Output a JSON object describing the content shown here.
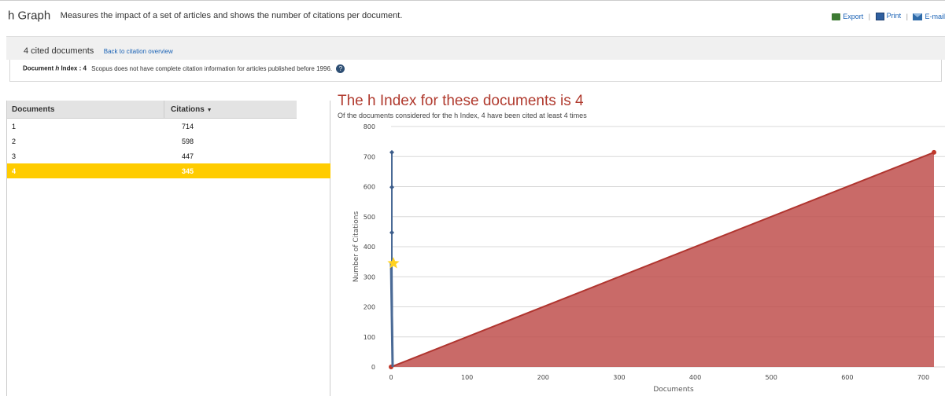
{
  "header": {
    "title": "h Graph",
    "description": "Measures the impact of a set of articles and shows the number of citations per document.",
    "export_label": "Export",
    "print_label": "Print",
    "email_label": "E-mail",
    "separator": "|"
  },
  "cited": {
    "count_text": "4 cited documents",
    "back_link": "Back to citation overview"
  },
  "hindex_box": {
    "prefix": "Document ",
    "h_letter": "h",
    "suffix": " Index : 4",
    "note": "Scopus does not have complete citation information for articles published before 1996.",
    "help_glyph": "?"
  },
  "table": {
    "col_documents": "Documents",
    "col_citations": "Citations",
    "sort_glyph": "▼",
    "rows": [
      {
        "doc": "1",
        "citations": "714"
      },
      {
        "doc": "2",
        "citations": "598"
      },
      {
        "doc": "3",
        "citations": "447"
      },
      {
        "doc": "4",
        "citations": "345"
      }
    ],
    "highlight_color": "#ffcc00"
  },
  "chart": {
    "title": "The h Index for these documents is 4",
    "subtitle": "Of the documents considered for the h Index, 4 have been cited at least 4 times"
  },
  "chart_data": {
    "type": "line",
    "xlabel": "Documents",
    "ylabel": "Number of Citations",
    "xlim": [
      0,
      714
    ],
    "ylim": [
      0,
      800
    ],
    "xticks": [
      0,
      100,
      200,
      300,
      400,
      500,
      600,
      700
    ],
    "yticks": [
      0,
      100,
      200,
      300,
      400,
      500,
      600,
      700,
      800
    ],
    "grid": true,
    "series": [
      {
        "kind": "line",
        "color": "#4a6a96",
        "x": [
          1,
          2,
          3,
          4
        ],
        "y": [
          714,
          598,
          447,
          345
        ]
      },
      {
        "kind": "area",
        "color": "#c0504d",
        "x": [
          0,
          714
        ],
        "y": [
          0,
          714
        ]
      }
    ],
    "h_index_marker": {
      "x": 4,
      "y": 345,
      "color": "#ffd21f"
    }
  }
}
